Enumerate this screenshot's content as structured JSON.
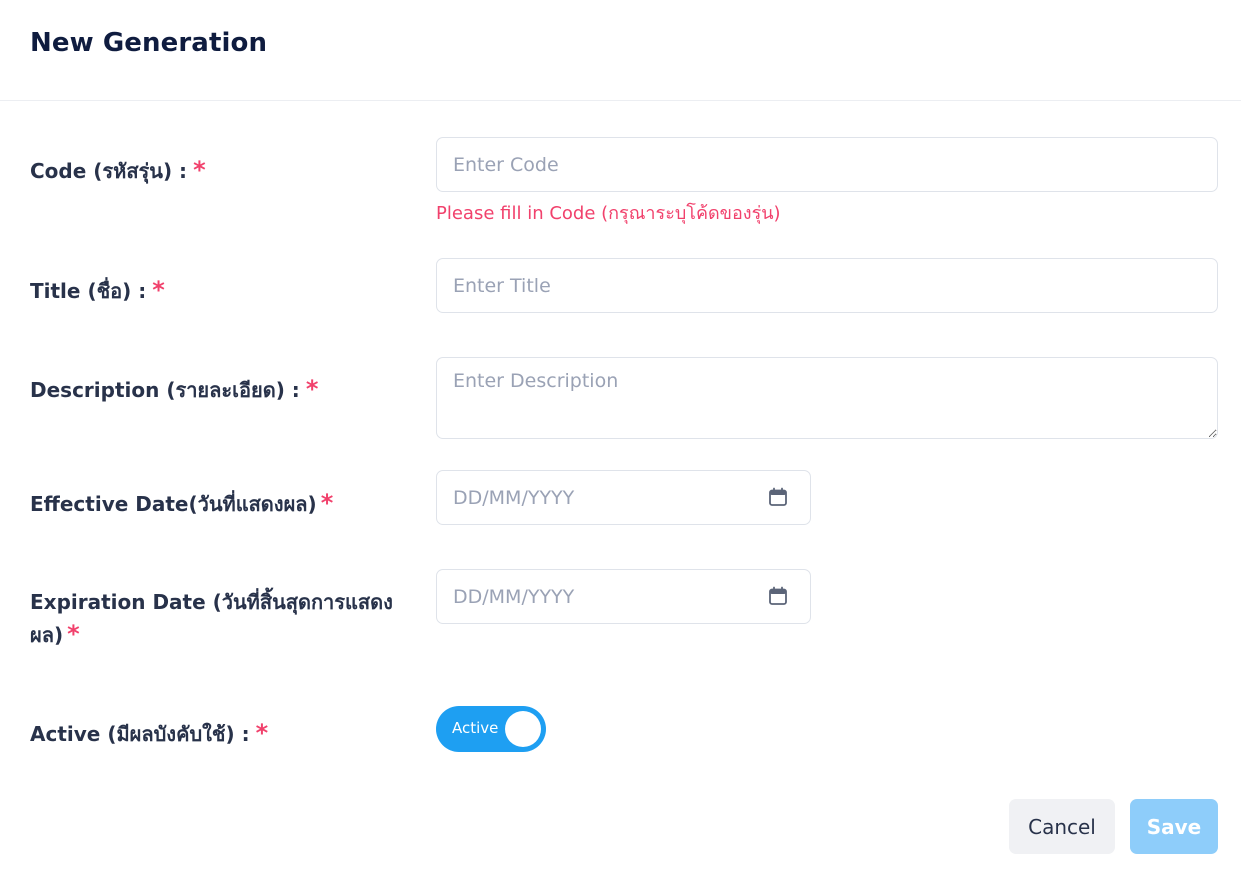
{
  "dialog": {
    "title": "New Generation"
  },
  "form": {
    "code": {
      "label": "Code (รหัสรุ่น) :",
      "required_mark": "*",
      "placeholder": "Enter Code",
      "value": "",
      "error": "Please fill in Code (กรุณาระบุโค้ดของรุ่น)"
    },
    "title": {
      "label": "Title (ชื่อ) :",
      "required_mark": "*",
      "placeholder": "Enter Title",
      "value": ""
    },
    "description": {
      "label": "Description (รายละเอียด) :",
      "required_mark": "*",
      "placeholder": "Enter Description",
      "value": ""
    },
    "effective_date": {
      "label": "Effective Date(วันที่แสดงผล)",
      "required_mark": "*",
      "placeholder": "DD/MM/YYYY",
      "value": "",
      "icon": "calendar-icon"
    },
    "expiration_date": {
      "label": "Expiration Date (วันที่สิ้นสุดการแสดงผล)",
      "required_mark": "*",
      "placeholder": "DD/MM/YYYY",
      "value": "",
      "icon": "calendar-icon"
    },
    "active": {
      "label": "Active (มีผลบังคับใช้) :",
      "required_mark": "*",
      "toggle_label": "Active",
      "checked": true
    }
  },
  "actions": {
    "cancel_label": "Cancel",
    "save_label": "Save"
  },
  "colors": {
    "primary": "#1e9ff2",
    "primary_disabled": "#8ecdfa",
    "required": "#f1416c",
    "error": "#f1416c",
    "heading": "#0f1c3f",
    "label": "#28324a",
    "placeholder": "#9aa2b5",
    "border": "#dfe3ea",
    "cancel_bg": "#f0f1f4"
  }
}
